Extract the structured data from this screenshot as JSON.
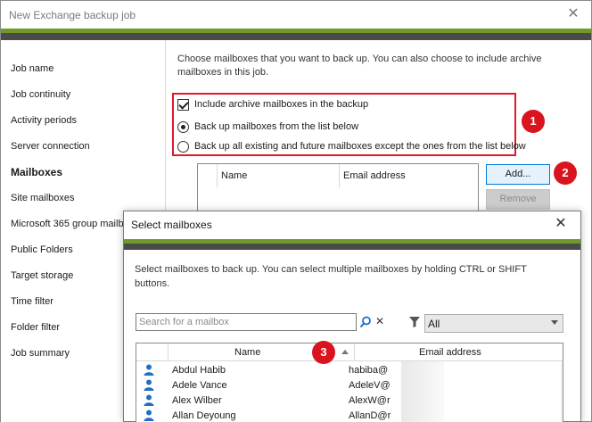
{
  "window": {
    "title": "New Exchange backup job",
    "close": "✕"
  },
  "sidebar": {
    "items": [
      {
        "label": "Job name"
      },
      {
        "label": "Job continuity"
      },
      {
        "label": "Activity periods"
      },
      {
        "label": "Server connection"
      },
      {
        "label": "Mailboxes"
      },
      {
        "label": "Site mailboxes"
      },
      {
        "label": "Microsoft 365 group mailbo"
      },
      {
        "label": "Public Folders"
      },
      {
        "label": "Target storage"
      },
      {
        "label": "Time filter"
      },
      {
        "label": "Folder filter"
      },
      {
        "label": "Job summary"
      }
    ]
  },
  "main": {
    "intro": "Choose mailboxes that you want to back up. You can also choose to include archive mailboxes in this job.",
    "options": {
      "include_archive": "Include archive mailboxes in the backup",
      "from_list": "Back up mailboxes from the list below",
      "except_list": "Back up all existing and future mailboxes except the ones from the list below"
    },
    "list_headers": {
      "name": "Name",
      "email": "Email address"
    },
    "buttons": {
      "add": "Add...",
      "remove": "Remove"
    }
  },
  "badges": [
    "1",
    "2",
    "3"
  ],
  "dialog": {
    "title": "Select mailboxes",
    "close": "✕",
    "intro": "Select mailboxes to back up. You can select multiple mailboxes by holding CTRL or SHIFT buttons.",
    "search_placeholder": "Search for a mailbox",
    "clear": "✕",
    "filter_value": "All",
    "headers": {
      "name": "Name",
      "email": "Email address"
    },
    "rows": [
      {
        "name": "Abdul Habib",
        "email": "habiba@"
      },
      {
        "name": "Adele Vance",
        "email": "AdeleV@"
      },
      {
        "name": "Alex Wilber",
        "email": "AlexW@r"
      },
      {
        "name": "Allan Deyoung",
        "email": "AllanD@r"
      }
    ]
  },
  "colors": {
    "accent_green": "#6f9a2b",
    "band_dark": "#4a4a4a",
    "highlight_red": "#e0192b",
    "badge_red": "#d9141f",
    "person_blue": "#1f6fc5"
  }
}
